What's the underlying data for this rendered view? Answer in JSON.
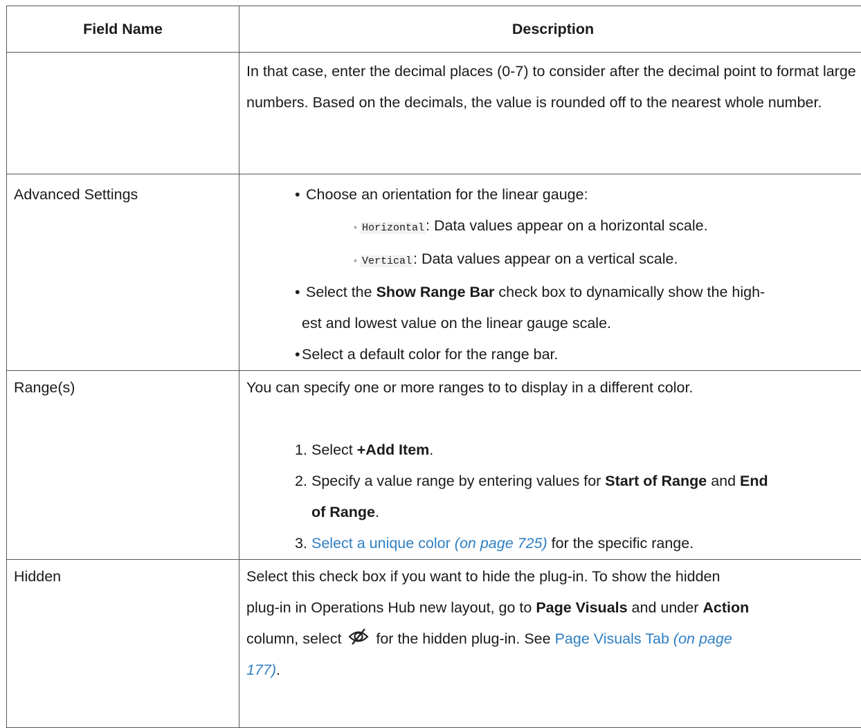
{
  "table": {
    "headers": {
      "field_name": "Field Name",
      "description": "Description"
    },
    "row1": {
      "field": "",
      "text": "In that case, enter the decimal places (0-7) to consider after the decimal point to format large numbers. Based on the decimals, the value is rounded off to the nearest whole number."
    },
    "row2": {
      "field": "Advanced Settings",
      "bullet1": "Choose an orientation for the linear gauge:",
      "sub1_code": "Horizontal",
      "sub1_text": ": Data values appear on a horizontal scale.",
      "sub2_code": "Vertical",
      "sub2_text": ": Data values appear on a vertical scale.",
      "bullet2_pre": "Select the ",
      "bullet2_bold": "Show Range Bar",
      "bullet2_post": " check box to dynamically show the high-",
      "bullet2_cont": "est and lowest value on the linear gauge scale.",
      "bullet3": "Select a default color for the range bar."
    },
    "row3": {
      "field": "Range(s)",
      "intro": "You can specify one or more ranges to to display in a different color.",
      "step1_num": "1.",
      "step1_pre": "Select ",
      "step1_bold": "+Add Item",
      "step1_post": ".",
      "step2_num": "2.",
      "step2_pre": "Specify a value range by entering values for ",
      "step2_bold1": "Start of Range",
      "step2_mid": " and ",
      "step2_bold2a": "End",
      "step2_bold2b": "of Range",
      "step2_post": ".",
      "step3_num": "3.",
      "step3_link": "Select a unique color",
      "step3_page": "(on page 725)",
      "step3_post": " for the specific range."
    },
    "row4": {
      "field": "Hidden",
      "line1": "Select this check box if you want to hide the plug-in. To show the hidden",
      "line2_pre": "plug-in in Operations Hub new layout, go to ",
      "line2_bold1": "Page Visuals",
      "line2_mid": " and under ",
      "line2_bold2": "Action",
      "line3_pre": "column, select ",
      "line3_post": " for the hidden plug-in. See ",
      "line3_link": "Page Visuals Tab",
      "line3_page": "(on page",
      "line4_page": "177)",
      "line4_post": "."
    }
  }
}
